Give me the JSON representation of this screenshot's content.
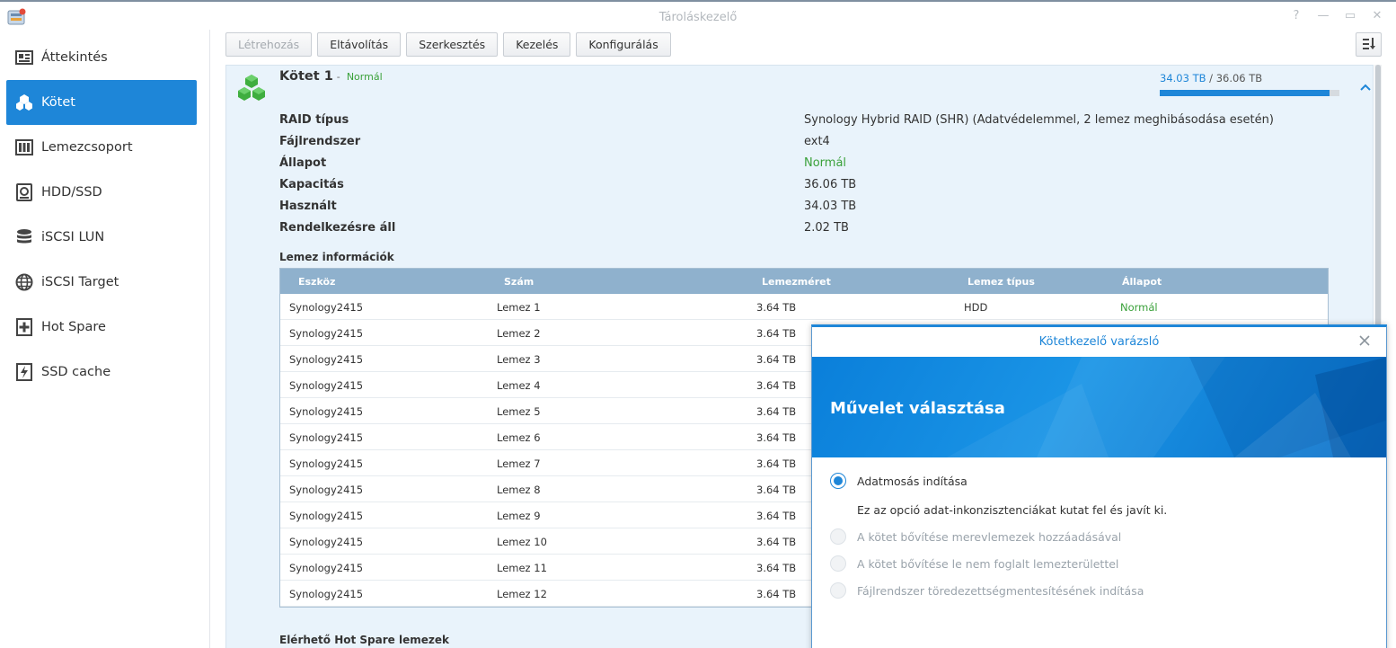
{
  "window": {
    "title": "Tároláskezelő",
    "buttons": [
      "help-icon",
      "pin-icon",
      "maximize-icon",
      "close-icon"
    ]
  },
  "sidebar": {
    "items": [
      {
        "label": "Áttekintés",
        "icon": "overview-icon",
        "active": false
      },
      {
        "label": "Kötet",
        "icon": "volume-icon",
        "active": true
      },
      {
        "label": "Lemezcsoport",
        "icon": "disk-group-icon",
        "active": false
      },
      {
        "label": "HDD/SSD",
        "icon": "hdd-icon",
        "active": false
      },
      {
        "label": "iSCSI LUN",
        "icon": "database-icon",
        "active": false
      },
      {
        "label": "iSCSI Target",
        "icon": "globe-icon",
        "active": false
      },
      {
        "label": "Hot Spare",
        "icon": "plus-box-icon",
        "active": false
      },
      {
        "label": "SSD cache",
        "icon": "lightning-icon",
        "active": false
      }
    ]
  },
  "toolbar": {
    "create": "Létrehozás",
    "remove": "Eltávolítás",
    "edit": "Szerkesztés",
    "manage": "Kezelés",
    "configure": "Konfigurálás"
  },
  "volume": {
    "name": "Kötet 1",
    "separator": "-",
    "status": "Normál",
    "used": "34.03 TB",
    "usage_separator": "/",
    "total": "36.06 TB",
    "usage_fraction": 0.944
  },
  "properties": [
    {
      "label": "RAID típus",
      "value": "Synology Hybrid RAID (SHR) (Adatvédelemmel, 2 lemez meghibásodása esetén)"
    },
    {
      "label": "Fájlrendszer",
      "value": "ext4"
    },
    {
      "label": "Állapot",
      "value": "Normál"
    },
    {
      "label": "Kapacitás",
      "value": "36.06 TB"
    },
    {
      "label": "Használt",
      "value": "34.03 TB"
    },
    {
      "label": "Rendelkezésre áll",
      "value": "2.02 TB"
    }
  ],
  "disk_info": {
    "title": "Lemez információk",
    "columns": [
      "Eszköz",
      "Szám",
      "Lemezméret",
      "Lemez típus",
      "Állapot"
    ],
    "rows": [
      [
        "Synology2415",
        "Lemez 1",
        "3.64 TB",
        "HDD",
        "Normál"
      ],
      [
        "Synology2415",
        "Lemez 2",
        "3.64 TB",
        "",
        ""
      ],
      [
        "Synology2415",
        "Lemez 3",
        "3.64 TB",
        "",
        ""
      ],
      [
        "Synology2415",
        "Lemez 4",
        "3.64 TB",
        "",
        ""
      ],
      [
        "Synology2415",
        "Lemez 5",
        "3.64 TB",
        "",
        ""
      ],
      [
        "Synology2415",
        "Lemez 6",
        "3.64 TB",
        "",
        ""
      ],
      [
        "Synology2415",
        "Lemez 7",
        "3.64 TB",
        "",
        ""
      ],
      [
        "Synology2415",
        "Lemez 8",
        "3.64 TB",
        "",
        ""
      ],
      [
        "Synology2415",
        "Lemez 9",
        "3.64 TB",
        "",
        ""
      ],
      [
        "Synology2415",
        "Lemez 10",
        "3.64 TB",
        "",
        ""
      ],
      [
        "Synology2415",
        "Lemez 11",
        "3.64 TB",
        "",
        ""
      ],
      [
        "Synology2415",
        "Lemez 12",
        "3.64 TB",
        "",
        ""
      ]
    ]
  },
  "hot_spare": {
    "title": "Elérhető Hot Spare lemezek"
  },
  "wizard": {
    "title": "Kötetkezelő varázsló",
    "heading": "Művelet választása",
    "options": [
      {
        "label": "Adatmosás indítása",
        "checked": true,
        "disabled": false
      },
      {
        "label": "A kötet bővítése merevlemezek hozzáadásával",
        "checked": false,
        "disabled": true
      },
      {
        "label": "A kötet bővítése le nem foglalt lemezterülettel",
        "checked": false,
        "disabled": true
      },
      {
        "label": "Fájlrendszer töredezettségmentesítésének indítása",
        "checked": false,
        "disabled": true
      }
    ],
    "description": "Ez az opció adat-inkonzisztenciákat kutat fel és javít ki."
  },
  "colors": {
    "accent": "#1e86d8",
    "ok_green": "#3aa13a",
    "panel_bg": "#e9f3fb",
    "table_header": "#8fb1cd"
  }
}
